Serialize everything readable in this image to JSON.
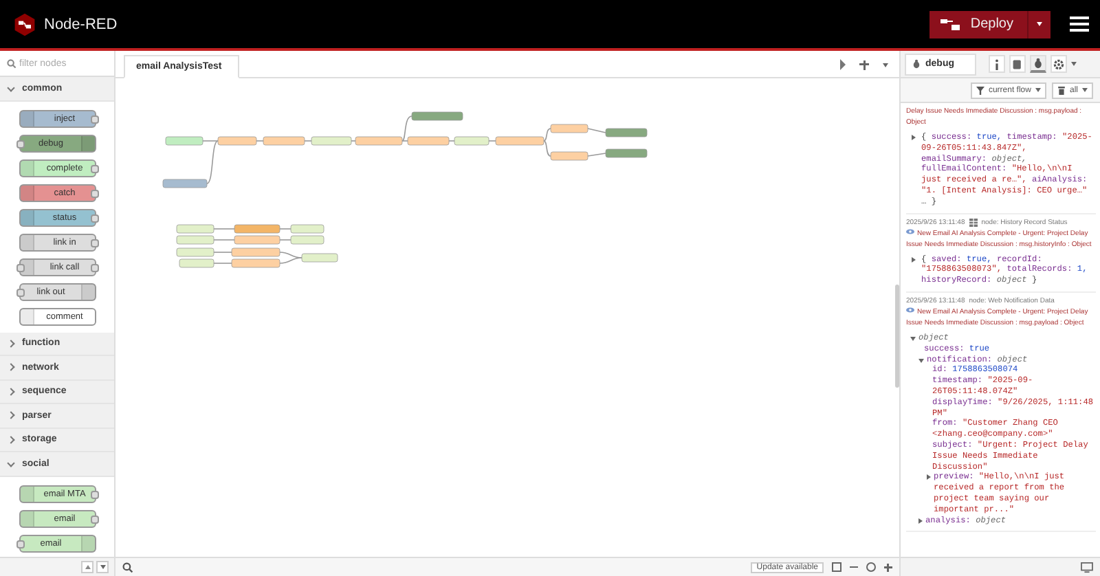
{
  "header": {
    "title": "Node-RED",
    "deploy": "Deploy"
  },
  "palette": {
    "filter_placeholder": "filter nodes",
    "categories": [
      {
        "name": "common",
        "expanded": true,
        "nodes": [
          {
            "label": "inject",
            "color": "#a6bbcf",
            "inputs": false,
            "outputs": true
          },
          {
            "label": "debug",
            "color": "#87a980",
            "inputs": true,
            "outputs": false
          },
          {
            "label": "complete",
            "color": "#c0edc0",
            "inputs": false,
            "outputs": true
          },
          {
            "label": "catch",
            "color": "#e49191",
            "inputs": false,
            "outputs": true
          },
          {
            "label": "status",
            "color": "#94c1d0",
            "inputs": false,
            "outputs": true
          },
          {
            "label": "link in",
            "color": "#dddddd",
            "inputs": false,
            "outputs": true
          },
          {
            "label": "link call",
            "color": "#dddddd",
            "inputs": true,
            "outputs": true
          },
          {
            "label": "link out",
            "color": "#dddddd",
            "inputs": true,
            "outputs": false
          },
          {
            "label": "comment",
            "color": "#ffffff",
            "inputs": false,
            "outputs": false
          }
        ]
      },
      {
        "name": "function",
        "expanded": false
      },
      {
        "name": "network",
        "expanded": false
      },
      {
        "name": "sequence",
        "expanded": false
      },
      {
        "name": "parser",
        "expanded": false
      },
      {
        "name": "storage",
        "expanded": false
      },
      {
        "name": "social",
        "expanded": true,
        "nodes": [
          {
            "label": "email MTA",
            "color": "#c7e9c0",
            "inputs": false,
            "outputs": true
          },
          {
            "label": "email",
            "color": "#c7e9c0",
            "inputs": false,
            "outputs": true
          },
          {
            "label": "email",
            "color": "#c7e9c0",
            "inputs": true,
            "outputs": false
          }
        ]
      }
    ]
  },
  "tabs": [
    {
      "label": "email AnalysisTest",
      "selected": true
    }
  ],
  "canvas_footer": {
    "update": "Update available"
  },
  "sidebar": {
    "tab": "debug",
    "filter": "current flow",
    "clear": "all",
    "messages": [
      {
        "topic": "Delay Issue Needs Immediate Discussion : msg.payload : Object",
        "summary": [
          {
            "text": "{",
            "kind": "punct"
          },
          {
            "text": "success:",
            "kind": "key"
          },
          {
            "text": "true,",
            "kind": "bool"
          },
          {
            "text": "timestamp:",
            "kind": "key"
          },
          {
            "text": "\"2025-09-26T05:11:43.847Z\",",
            "kind": "string"
          },
          {
            "text": "emailSummary:",
            "kind": "key"
          },
          {
            "text": "object,",
            "kind": "type"
          },
          {
            "text": "fullEmailContent:",
            "kind": "key"
          },
          {
            "text": "\"Hello,\\n\\nI just received a re…\",",
            "kind": "string"
          },
          {
            "text": "aiAnalysis:",
            "kind": "key"
          },
          {
            "text": "\"1. [Intent Analysis]: CEO urge…\"",
            "kind": "string"
          },
          {
            "text": "… }",
            "kind": "punct"
          }
        ]
      },
      {
        "time": "2025/9/26 13:11:48",
        "node": "node: History Record Status",
        "topic": "New Email AI Analysis Complete - Urgent: Project Delay Issue Needs Immediate Discussion : msg.historyInfo : Object",
        "summary": [
          {
            "text": "{",
            "kind": "punct"
          },
          {
            "text": "saved:",
            "kind": "key"
          },
          {
            "text": "true,",
            "kind": "bool"
          },
          {
            "text": "recordId:",
            "kind": "key"
          },
          {
            "text": "\"1758863508073\",",
            "kind": "string"
          },
          {
            "text": "totalRecords:",
            "kind": "key"
          },
          {
            "text": "1,",
            "kind": "number"
          },
          {
            "text": "historyRecord:",
            "kind": "key"
          },
          {
            "text": "object",
            "kind": "type"
          },
          {
            "text": "}",
            "kind": "punct"
          }
        ]
      },
      {
        "time": "2025/9/26 13:11:48",
        "node": "node: Web Notification Data",
        "topic": "New Email AI Analysis Complete - Urgent: Project Delay Issue Needs Immediate Discussion : msg.payload : Object",
        "tree": {
          "value": "object",
          "kind": "type",
          "expanded": true,
          "children": [
            {
              "key": "success:",
              "value": "true",
              "kind": "bool"
            },
            {
              "key": "notification:",
              "value": "object",
              "kind": "type",
              "expanded": true,
              "children": [
                {
                  "key": "id:",
                  "value": "1758863508074",
                  "kind": "number"
                },
                {
                  "key": "timestamp:",
                  "value": "\"2025-09-26T05:11:48.074Z\"",
                  "kind": "string"
                },
                {
                  "key": "displayTime:",
                  "value": "\"9/26/2025, 1:11:48 PM\"",
                  "kind": "string"
                },
                {
                  "key": "from:",
                  "value": "\"Customer Zhang CEO <zhang.ceo@company.com>\"",
                  "kind": "string"
                },
                {
                  "key": "subject:",
                  "value": "\"Urgent: Project Delay Issue Needs Immediate Discussion\"",
                  "kind": "string"
                },
                {
                  "key": "preview:",
                  "value": "\"Hello,\\n\\nI just received a report from the project team saying our important pr...\"",
                  "kind": "string",
                  "expanded": false
                }
              ]
            },
            {
              "key": "analysis:",
              "value": "object",
              "kind": "type",
              "expanded": false
            }
          ]
        }
      }
    ]
  }
}
